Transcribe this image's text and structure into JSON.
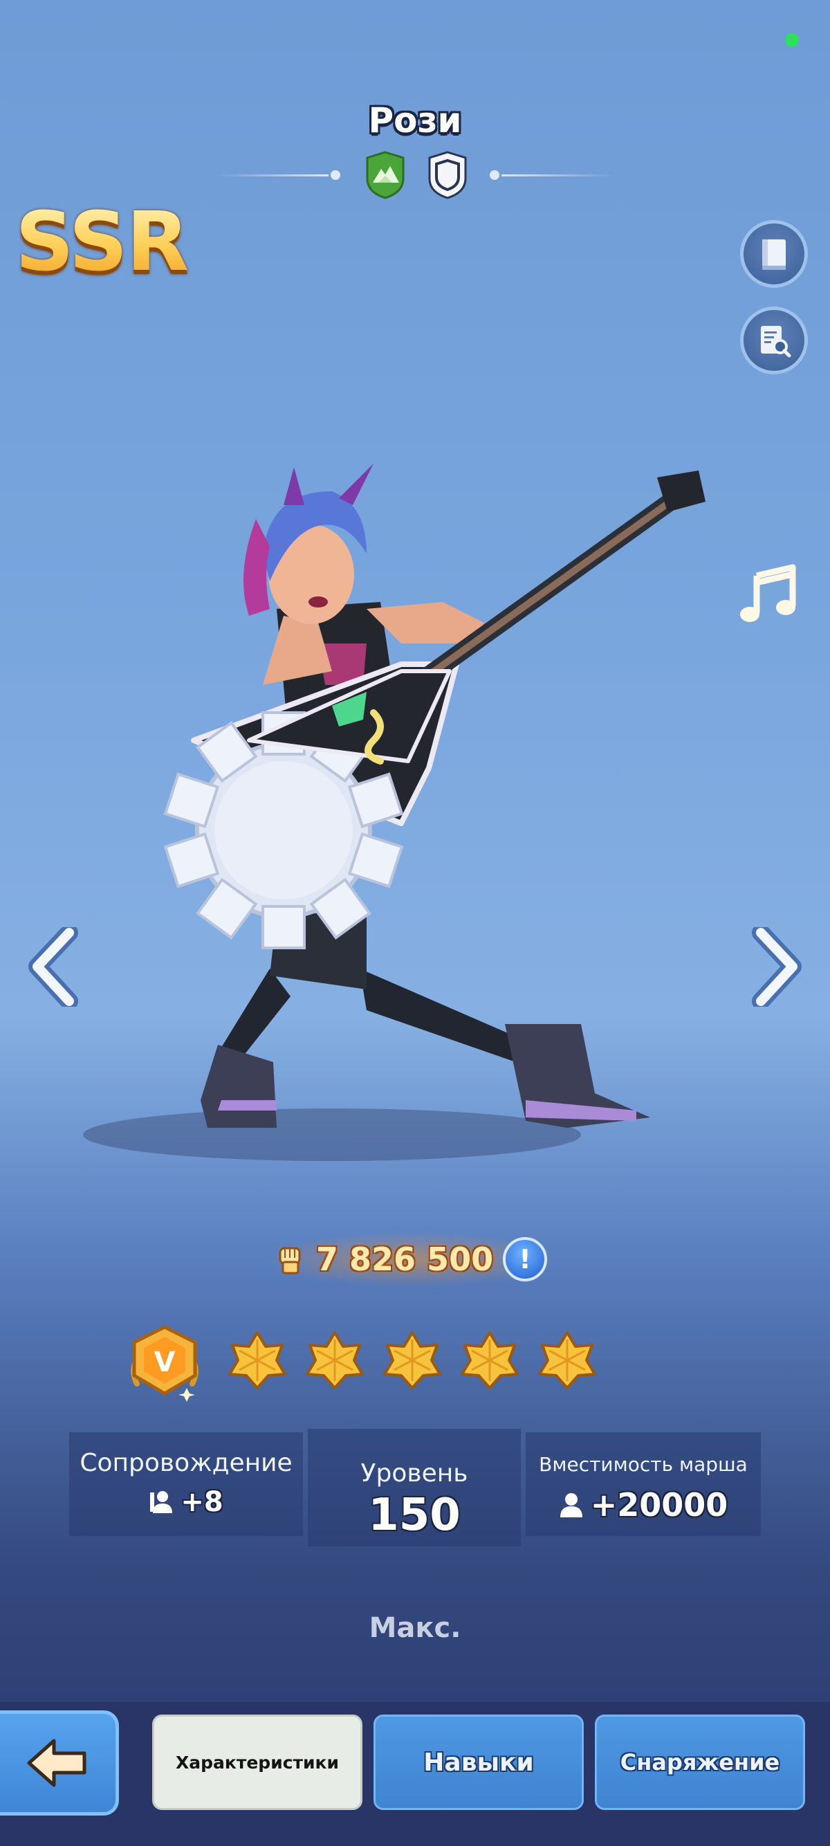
{
  "hero": {
    "name": "Рози",
    "rarity": "SSR",
    "power": "7 826 500",
    "stars_count": 5
  },
  "stats": {
    "escort_label": "Сопровождение",
    "escort_value": "+8",
    "level_label": "Уровень",
    "level_value": "150",
    "march_label": "Вместимость марша",
    "march_value": "+20000",
    "max_label": "Макс."
  },
  "tabs": {
    "characteristics": "Характеристики",
    "skills": "Навыки",
    "equipment": "Снаряжение"
  },
  "icons": {
    "faction": "mountain-badge-icon",
    "role": "shield-badge-icon",
    "codex": "book-icon",
    "details": "document-search-icon",
    "music": "music-note-icon",
    "power": "fist-icon",
    "info": "exclamation-icon",
    "vip": "v-badge-icon",
    "back": "back-arrow-icon"
  },
  "colors": {
    "rarity_gold": "#ffcf57",
    "status_green": "#2ee05a",
    "tab_blue": "#4f98e3",
    "tab_active": "#e8ece6"
  }
}
